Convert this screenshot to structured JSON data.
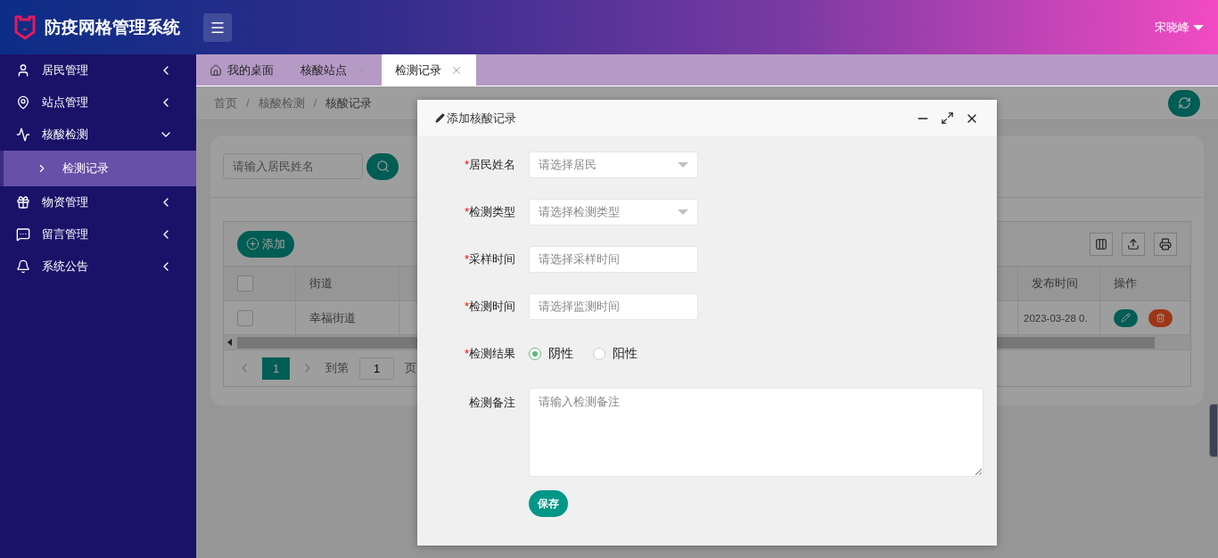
{
  "header": {
    "title": "防疫网格管理系统",
    "user": "宋晓峰"
  },
  "sidebar": {
    "items": [
      {
        "label": "居民管理",
        "expanded": false
      },
      {
        "label": "站点管理",
        "expanded": false
      },
      {
        "label": "核酸检测",
        "expanded": true,
        "children": [
          {
            "label": "检测记录",
            "selected": true
          }
        ]
      },
      {
        "label": "物资管理",
        "expanded": false
      },
      {
        "label": "留言管理",
        "expanded": false
      },
      {
        "label": "系统公告",
        "expanded": false
      }
    ]
  },
  "tabs": [
    {
      "label": "我的桌面",
      "selected": false,
      "closable": false
    },
    {
      "label": "核酸站点",
      "selected": false,
      "closable": true
    },
    {
      "label": "检测记录",
      "selected": true,
      "closable": true
    }
  ],
  "breadcrumb": {
    "separator": "/",
    "items": [
      "首页",
      "核酸检测",
      "核酸记录"
    ]
  },
  "search": {
    "placeholder": "请输入居民姓名"
  },
  "table": {
    "add_button": "添加",
    "header_checked": false,
    "columns_left": [
      "街道"
    ],
    "columns_right": [
      "发布时间",
      "操作"
    ],
    "rows": [
      {
        "checked": false,
        "cells_left": [
          "幸福街道"
        ],
        "cells_right": [
          "2023-03-28 0."
        ]
      }
    ]
  },
  "pagination": {
    "pages": [
      {
        "label": "1",
        "selected": true
      }
    ],
    "goto_label": "到第",
    "goto_value": "1",
    "page_label": "页"
  },
  "dialog": {
    "title": "添加核酸记录",
    "save_button": "保存",
    "required_mark": "*",
    "fields": [
      {
        "kind": "select",
        "label": "居民姓名",
        "required": true,
        "placeholder": "请选择居民"
      },
      {
        "kind": "select",
        "label": "检测类型",
        "required": true,
        "placeholder": "请选择检测类型"
      },
      {
        "kind": "input",
        "label": "采样时间",
        "required": true,
        "placeholder": "请选择采样时间"
      },
      {
        "kind": "input",
        "label": "检测时间",
        "required": true,
        "placeholder": "请选择监测时间"
      },
      {
        "kind": "radio",
        "label": "检测结果",
        "required": true,
        "options": [
          {
            "label": "阴性",
            "selected": true
          },
          {
            "label": "阳性",
            "selected": false
          }
        ]
      },
      {
        "kind": "textarea",
        "label": "检测备注",
        "required": false,
        "placeholder": "请输入检测备注"
      }
    ]
  }
}
